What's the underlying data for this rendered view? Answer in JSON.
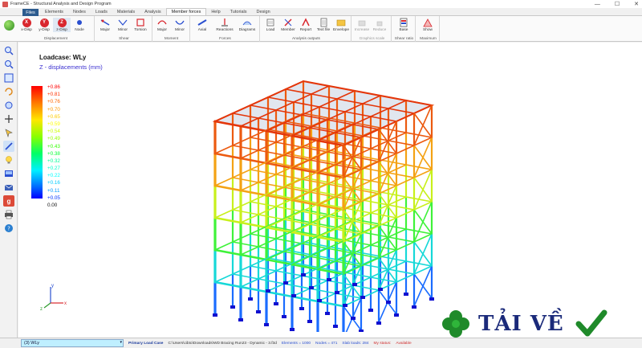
{
  "window": {
    "title": "FrameCE - Structural Analysis and Design Program",
    "min": "—",
    "max": "☐",
    "close": "✕"
  },
  "menu": {
    "files": "Files",
    "tabs": [
      "Elements",
      "Nodes",
      "Loads",
      "Materials",
      "Analysis",
      "Member forces",
      "Help",
      "Tutorials",
      "Design"
    ],
    "active_index": 5
  },
  "ribbon": {
    "groups": [
      {
        "label": "Displacement",
        "buttons": [
          "x-Disp",
          "y-Disp",
          "z-Disp",
          "Node"
        ]
      },
      {
        "label": "Shear",
        "buttons": [
          "Major",
          "Minor",
          "Torsion"
        ]
      },
      {
        "label": "Moment",
        "buttons": [
          "Major",
          "Minor"
        ]
      },
      {
        "label": "Forces",
        "buttons": [
          "Axial",
          "Reactions",
          "Diagrams"
        ]
      },
      {
        "label": "Analysis outputs",
        "buttons": [
          "Load",
          "Member",
          "Report",
          "Text file",
          "Envelope"
        ]
      },
      {
        "label": "Graphics scale",
        "buttons": [
          "Increase",
          "Reduce"
        ]
      },
      {
        "label": "Shear ratio",
        "buttons": [
          "Base"
        ]
      },
      {
        "label": "Maximum",
        "buttons": [
          "Show"
        ]
      }
    ]
  },
  "canvas": {
    "loadcase_title": "Loadcase: WLy",
    "result_subtitle": "Z - displacements (mm)",
    "legend": [
      "+0.86",
      "+0.81",
      "+0.76",
      "+0.70",
      "+0.65",
      "+0.59",
      "+0.54",
      "+0.49",
      "+0.43",
      "+0.38",
      "+0.32",
      "+0.27",
      "+0.22",
      "+0.16",
      "+0.11",
      "+0.05",
      "0.00"
    ],
    "legend_colors": [
      "#ff0000",
      "#ff3300",
      "#ff6600",
      "#ff9900",
      "#ffcc00",
      "#ffff00",
      "#ccff00",
      "#99ff00",
      "#33ff00",
      "#00ff33",
      "#00ff99",
      "#00ffcc",
      "#00ffff",
      "#00ccff",
      "#0099ff",
      "#0033ff",
      "#0000ff"
    ],
    "axes": {
      "x": "x",
      "y": "y",
      "z": "z"
    }
  },
  "status": {
    "loadcase_select": "(3) WLy",
    "primary": "Primary Load Case",
    "path": "C:\\Users\\cibto\\Downloads\\WD Bracing Run23 - Dynamic - 3.f3d",
    "elements": "Elements = 1000",
    "nodes": "Nodes = 471",
    "slab_loads": "Slab loads: 284",
    "my_status_label": "My status:",
    "my_status_value": "Available"
  },
  "watermark": {
    "text": "TẢI VỀ"
  }
}
